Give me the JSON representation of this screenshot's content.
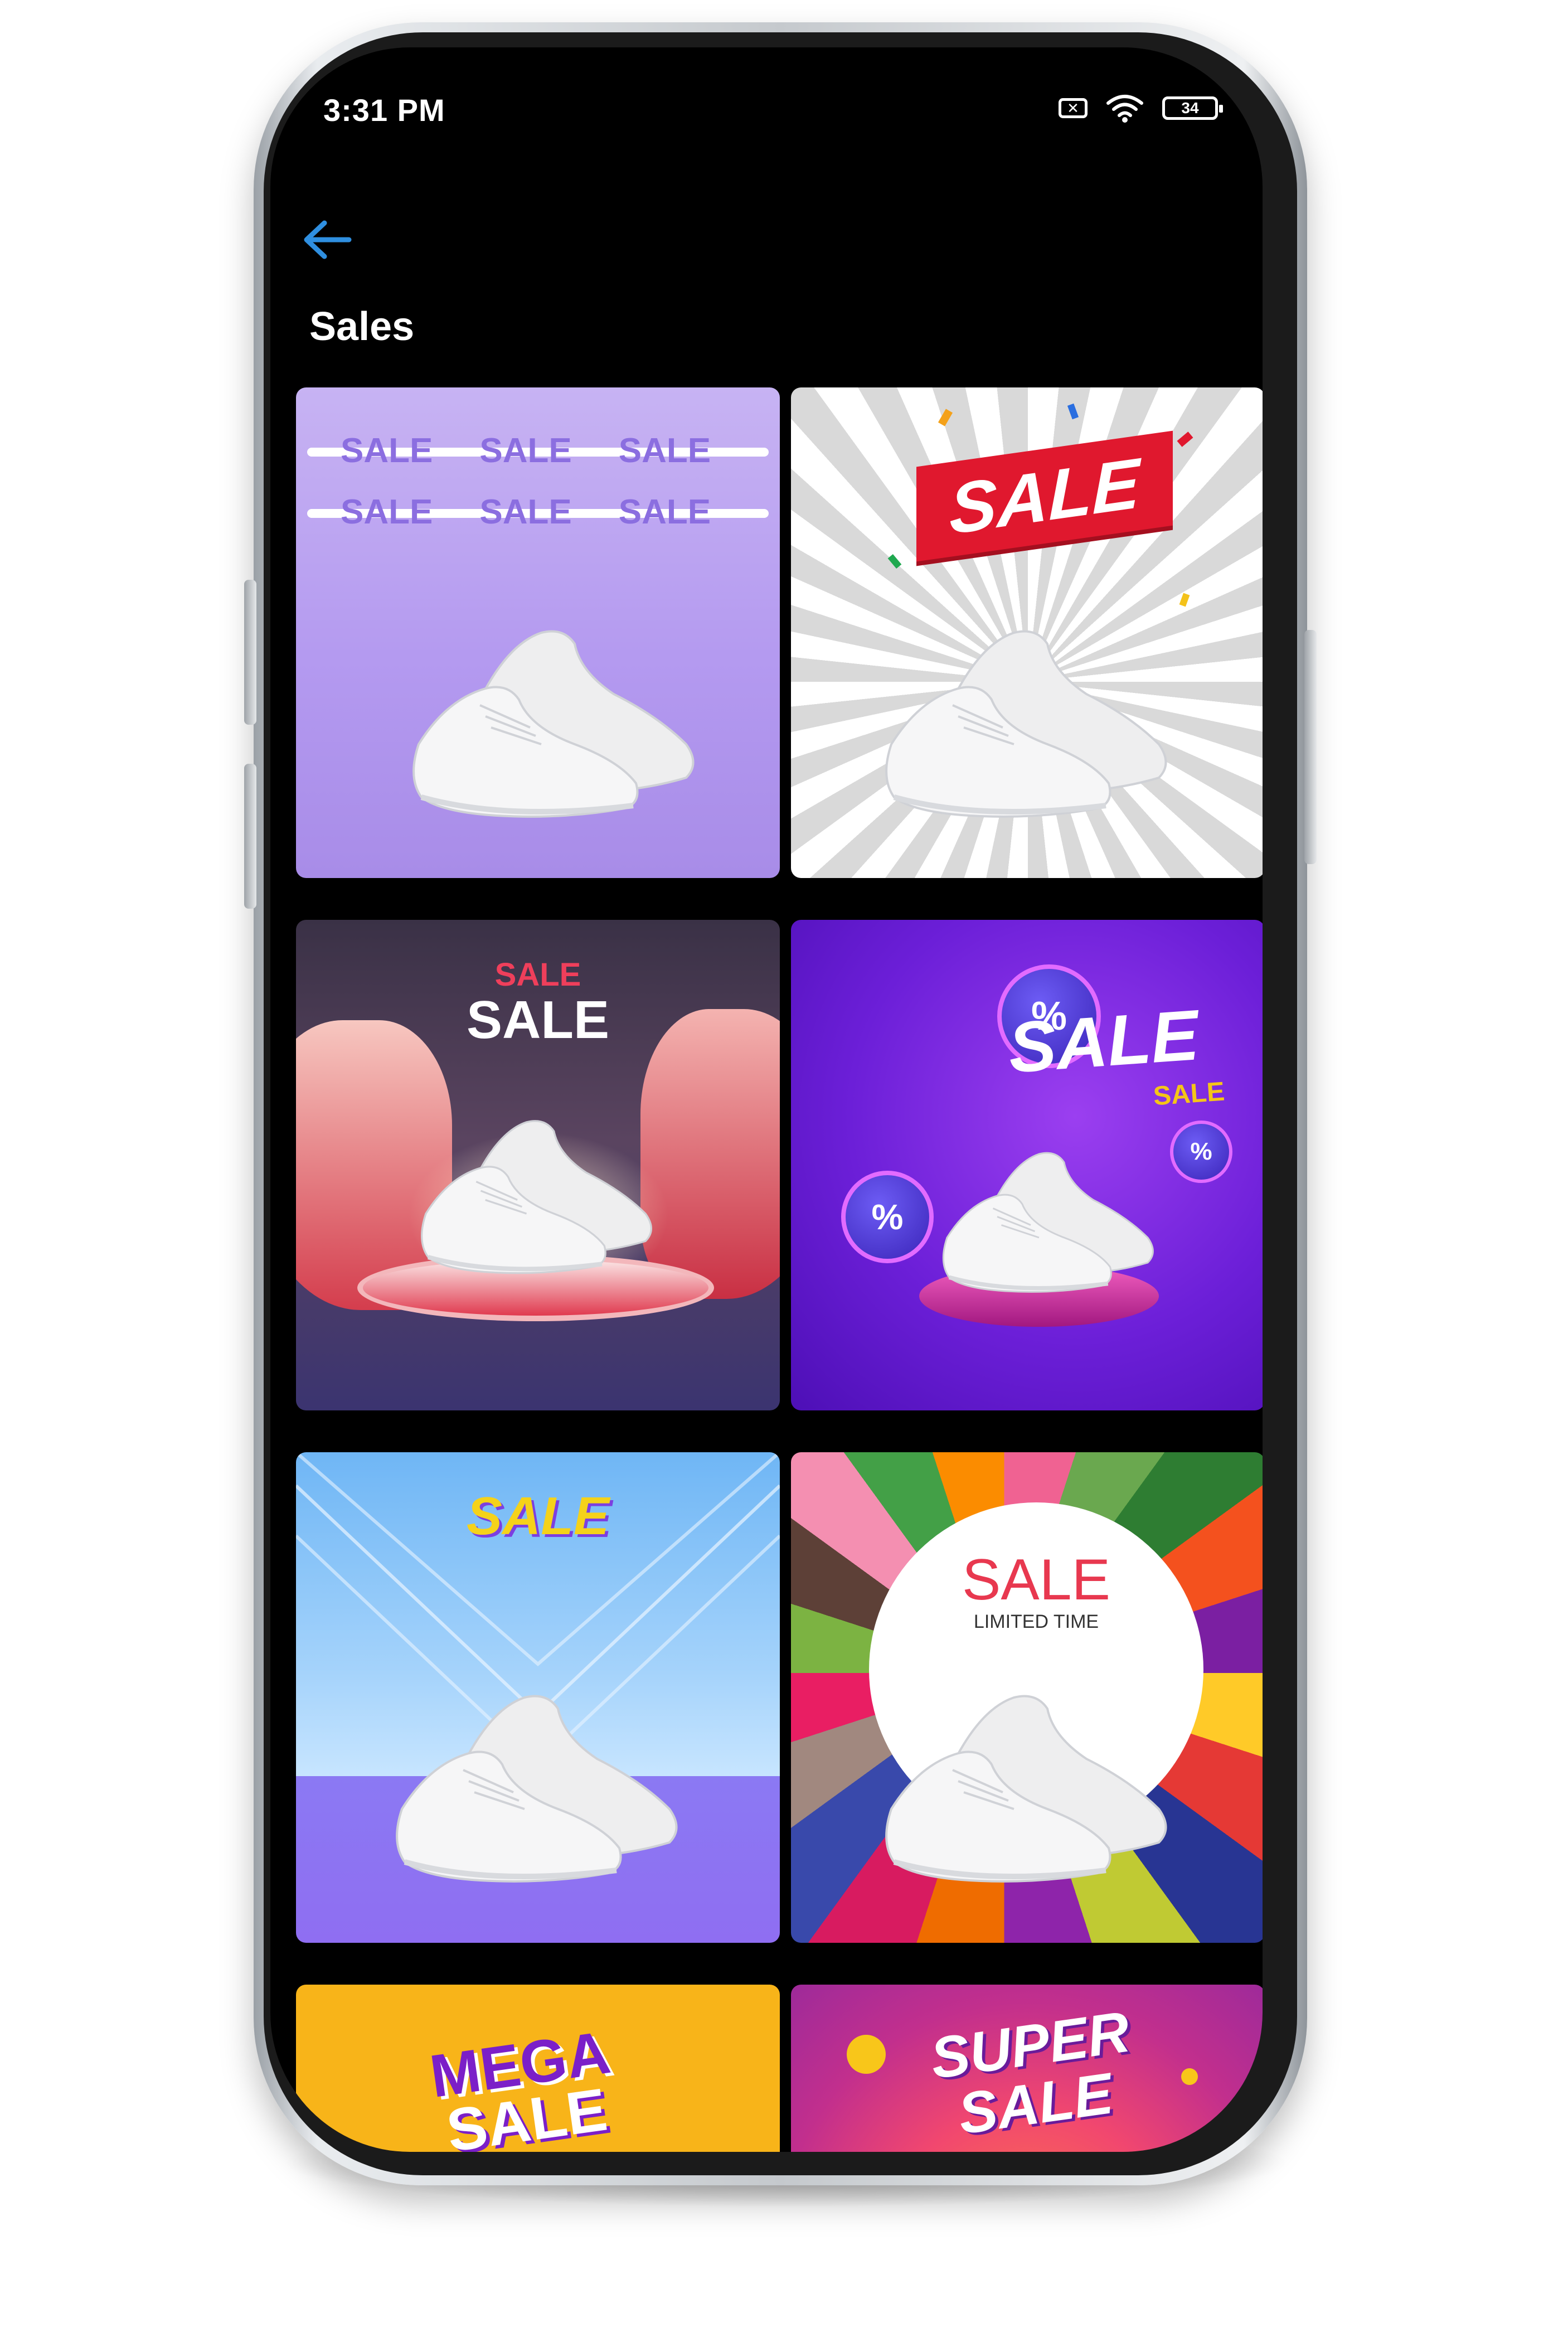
{
  "status_bar": {
    "time": "3:31 PM",
    "sim_icon": "✕",
    "wifi_icon": "wifi-icon",
    "battery": "34"
  },
  "header": {
    "back_icon": "arrow-left-icon",
    "title": "Sales"
  },
  "colors": {
    "accent": "#2f8fe0",
    "background": "#000000",
    "title_text": "#ffffff"
  },
  "tiles": [
    {
      "word": "SALE"
    },
    {
      "word": "SALE"
    },
    {
      "word_top": "SALE",
      "word_main": "SALE"
    },
    {
      "word_main": "SALE",
      "word_small": "SALE"
    },
    {
      "word": "SALE"
    },
    {
      "word": "SALE",
      "subtitle": "LIMITED TIME"
    },
    {
      "line1": "MEGA",
      "line2": "SALE"
    },
    {
      "line1": "SUPER",
      "line2": "SALE"
    }
  ]
}
